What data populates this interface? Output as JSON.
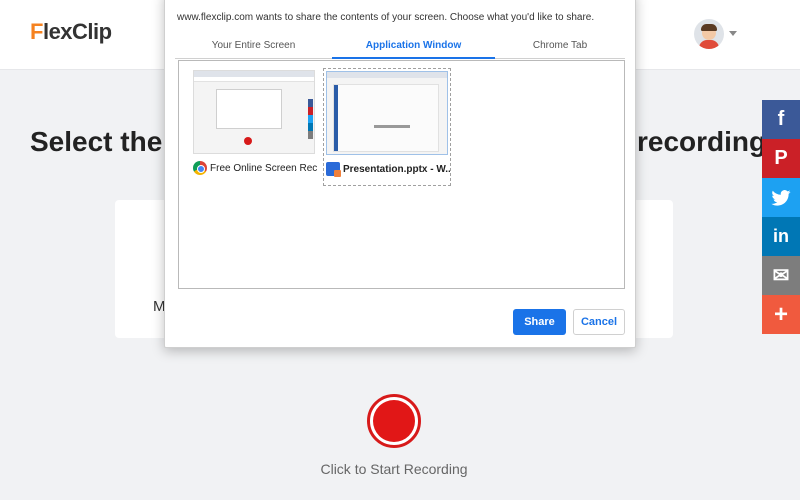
{
  "header": {
    "logo_prefix": "F",
    "logo_rest": "lexClip"
  },
  "main": {
    "headline_left": "Select the a",
    "headline_right": "recording",
    "card_letter": "M",
    "record_label": "Click to Start Recording"
  },
  "dialog": {
    "message": "www.flexclip.com wants to share the contents of your screen. Choose what you'd like to share.",
    "tabs": [
      {
        "label": "Your Entire Screen"
      },
      {
        "label": "Application Window"
      },
      {
        "label": "Chrome Tab"
      }
    ],
    "windows": [
      {
        "title": "Free Online Screen Reco...",
        "icon": "chrome-icon"
      },
      {
        "title": "Presentation.pptx - W...",
        "icon": "wps-presentation-icon"
      }
    ],
    "share_label": "Share",
    "cancel_label": "Cancel"
  },
  "social": [
    {
      "glyph": "f",
      "icon": "facebook-icon",
      "color": "#3b5998"
    },
    {
      "glyph": "P",
      "icon": "pinterest-icon",
      "color": "#cb2027"
    },
    {
      "glyph": "🐦",
      "icon": "twitter-icon",
      "color": "#1da1f2"
    },
    {
      "glyph": "in",
      "icon": "linkedin-icon",
      "color": "#0077b5"
    },
    {
      "glyph": "✉",
      "icon": "email-icon",
      "color": "#7d7d7d"
    },
    {
      "glyph": "+",
      "icon": "plus-icon",
      "color": "#f05a3e"
    }
  ],
  "colors": {
    "accent": "#1a73e8",
    "record": "#e11717",
    "logo": "#f58220"
  }
}
